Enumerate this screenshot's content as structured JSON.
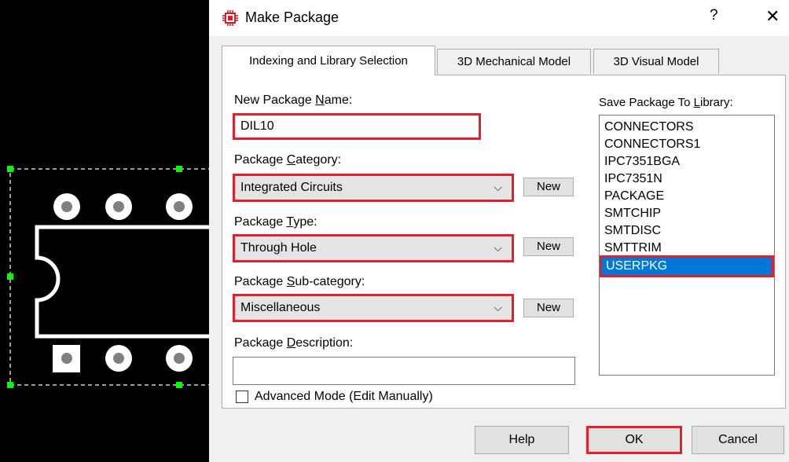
{
  "dialog": {
    "title": "Make Package",
    "help_glyph": "?",
    "close_glyph": "✕"
  },
  "tabs": [
    {
      "label": "Indexing and Library Selection",
      "active": true
    },
    {
      "label": "3D Mechanical Model",
      "active": false
    },
    {
      "label": "3D Visual Model",
      "active": false
    }
  ],
  "form": {
    "name_label_pre": "New Package ",
    "name_label_ul": "N",
    "name_label_post": "ame:",
    "name_value": "DIL10",
    "category_label_pre": "Package ",
    "category_label_ul": "C",
    "category_label_post": "ategory:",
    "category_value": "Integrated Circuits",
    "type_label_pre": "Package ",
    "type_label_ul": "T",
    "type_label_post": "ype:",
    "type_value": "Through Hole",
    "subcat_label_pre": "Package ",
    "subcat_label_ul": "S",
    "subcat_label_post": "ub-category:",
    "subcat_value": "Miscellaneous",
    "desc_label_pre": "Package ",
    "desc_label_ul": "D",
    "desc_label_post": "escription:",
    "desc_value": "",
    "new_label": "New",
    "advanced_label": "Advanced Mode (Edit Manually)",
    "advanced_checked": false
  },
  "library": {
    "label_pre": "Save Package To ",
    "label_ul": "L",
    "label_post": "ibrary:",
    "items": [
      "CONNECTORS",
      "CONNECTORS1",
      "IPC7351BGA",
      "IPC7351N",
      "PACKAGE",
      "SMTCHIP",
      "SMTDISC",
      "SMTTRIM"
    ],
    "selected": "USERPKG"
  },
  "buttons": {
    "help": "Help",
    "ok": "OK",
    "cancel": "Cancel"
  },
  "colors": {
    "highlight_border": "#e0202c",
    "selection": "#0078d7",
    "pcb_background": "#000000",
    "handle": "#00ff00"
  }
}
